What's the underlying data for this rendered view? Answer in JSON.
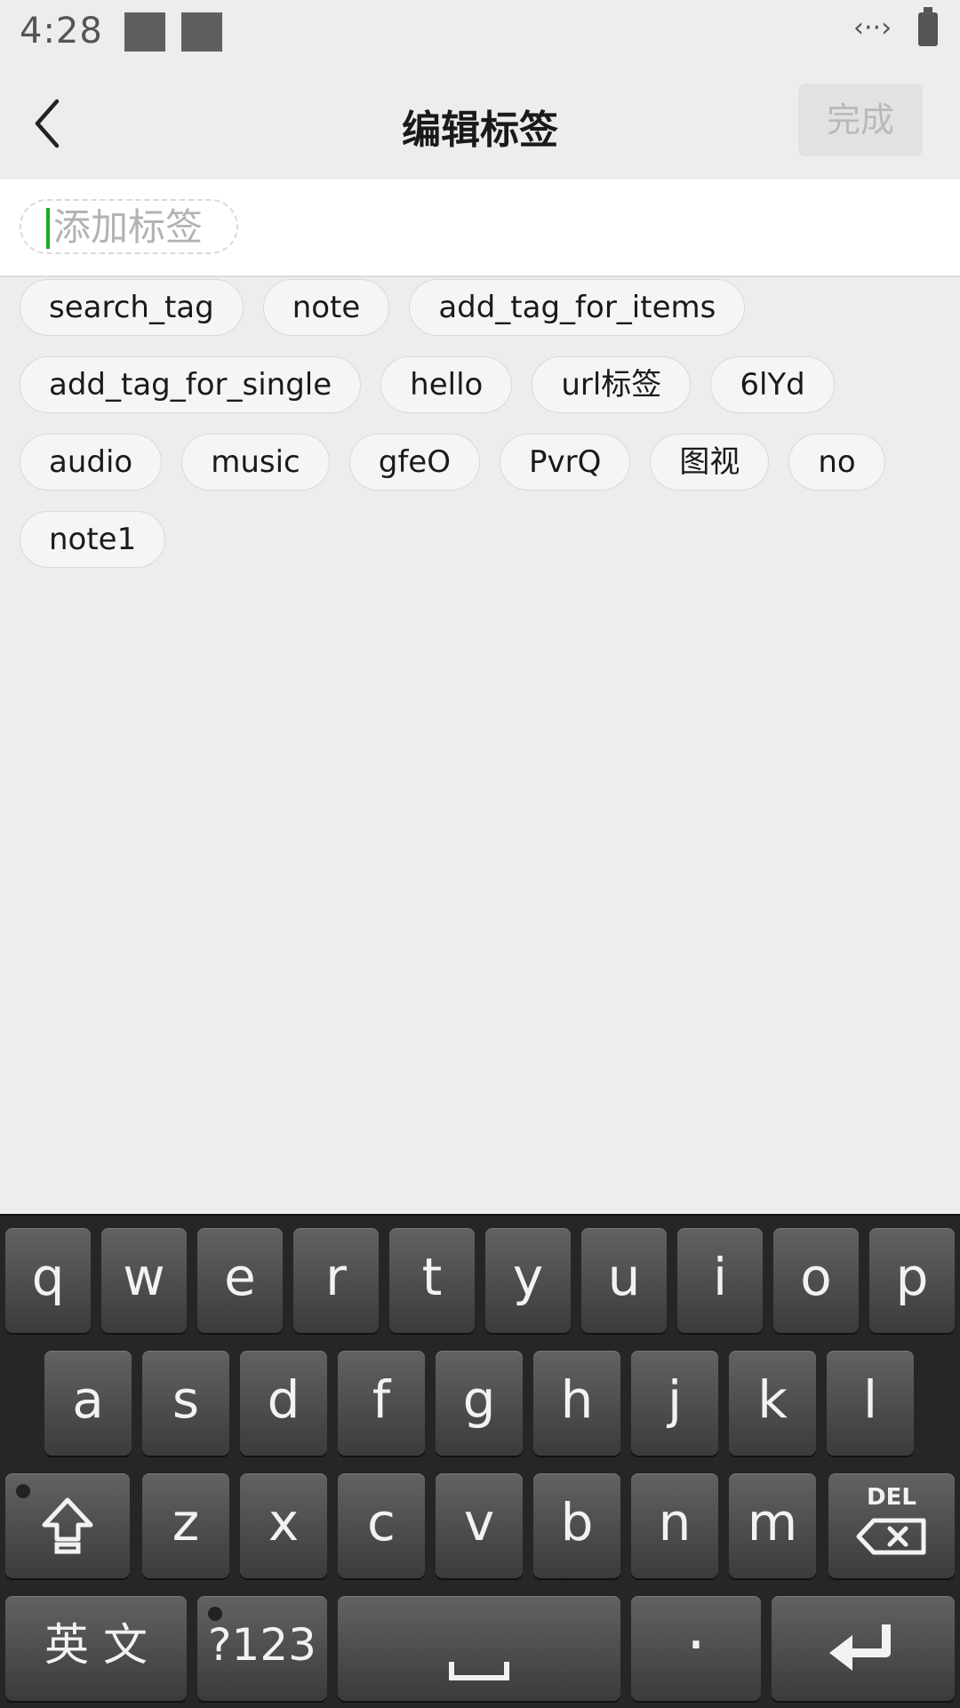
{
  "status_bar": {
    "time": "4:28",
    "link_symbol": "‹··›"
  },
  "header": {
    "title": "编辑标签",
    "done_label": "完成"
  },
  "input": {
    "placeholder": "添加标签",
    "value": ""
  },
  "tags": {
    "row1": [
      "search_tag",
      "note",
      "add_tag_for_items"
    ],
    "row2": [
      "add_tag_for_single",
      "hello",
      "url标签",
      "6lYd"
    ],
    "row3": [
      "audio",
      "music",
      "gfeO",
      "PvrQ",
      "图视",
      "no"
    ],
    "row4": [
      "note1"
    ]
  },
  "keyboard": {
    "row1": [
      "q",
      "w",
      "e",
      "r",
      "t",
      "y",
      "u",
      "i",
      "o",
      "p"
    ],
    "row2": [
      "a",
      "s",
      "d",
      "f",
      "g",
      "h",
      "j",
      "k",
      "l"
    ],
    "row3": [
      "z",
      "x",
      "c",
      "v",
      "b",
      "n",
      "m"
    ],
    "shift_icon": "shift-arrow-icon",
    "del_label": "DEL",
    "lang_label": "英 文",
    "symbols_label": "?123",
    "period_label": "·",
    "enter_icon": "enter-return-icon",
    "space_icon": "space-bar-icon"
  },
  "colors": {
    "accent": "#1aad19",
    "page_bg": "#ededed",
    "keyboard_bg": "#262626"
  }
}
